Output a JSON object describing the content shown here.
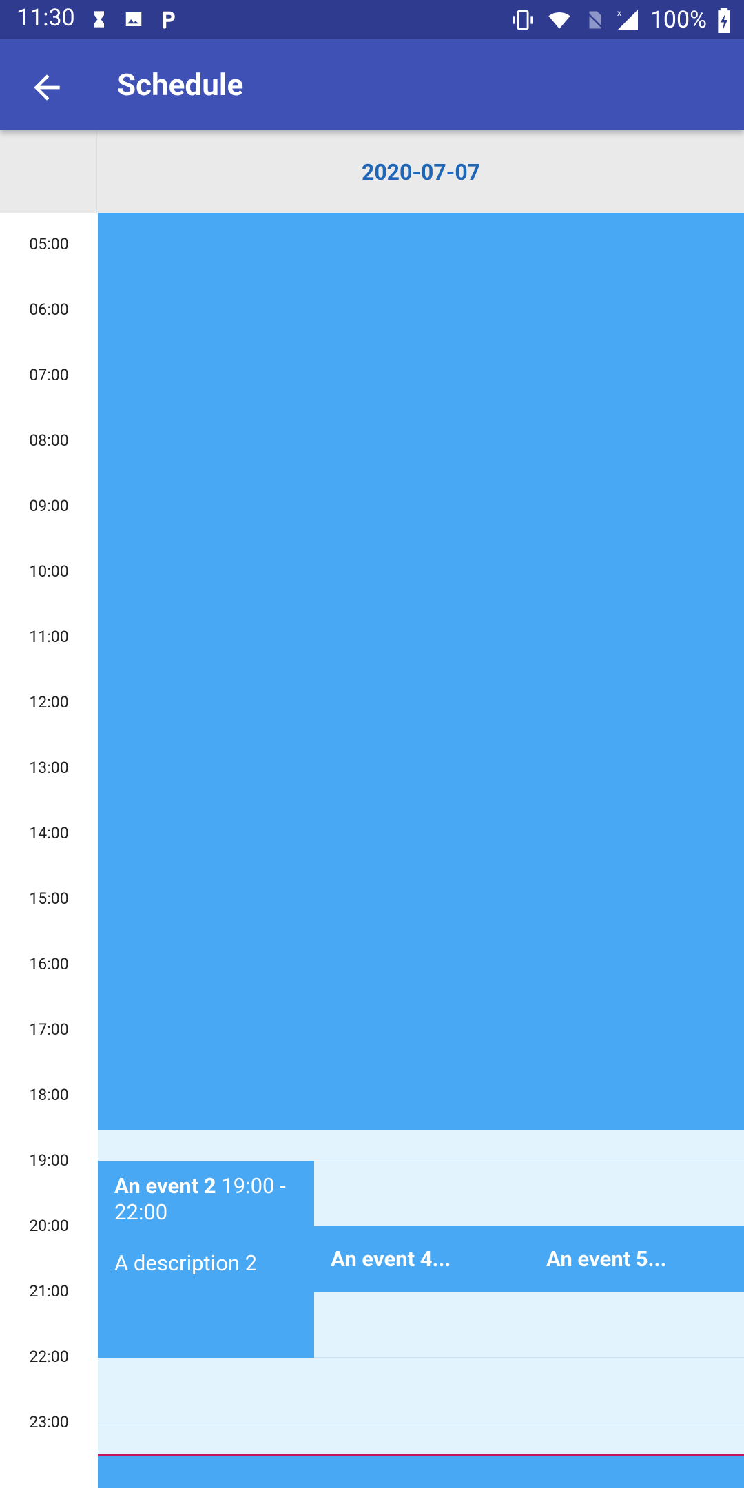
{
  "status_bar": {
    "time": "11:30",
    "battery_percent": "100%"
  },
  "app_bar": {
    "title": "Schedule",
    "back_icon": "arrow-left-icon"
  },
  "day_header": {
    "date": "2020-07-07"
  },
  "timeline": {
    "hours": [
      "05:00",
      "06:00",
      "07:00",
      "08:00",
      "09:00",
      "10:00",
      "11:00",
      "12:00",
      "13:00",
      "14:00",
      "15:00",
      "16:00",
      "17:00",
      "18:00",
      "19:00",
      "20:00",
      "21:00",
      "22:00",
      "23:00"
    ]
  },
  "events": [
    {
      "title": "An event 2",
      "time": "19:00",
      "time_end": "- 22:00",
      "description": "A description 2"
    },
    {
      "title": "An event 4..."
    },
    {
      "title": "An event 5..."
    }
  ],
  "colors": {
    "status_bar": "#2f3b8f",
    "app_bar": "#3f51b5",
    "event": "#49a8f3",
    "day_background": "#e3f3fd",
    "date_text": "#1e66b8",
    "now_line": "#c2185b"
  }
}
